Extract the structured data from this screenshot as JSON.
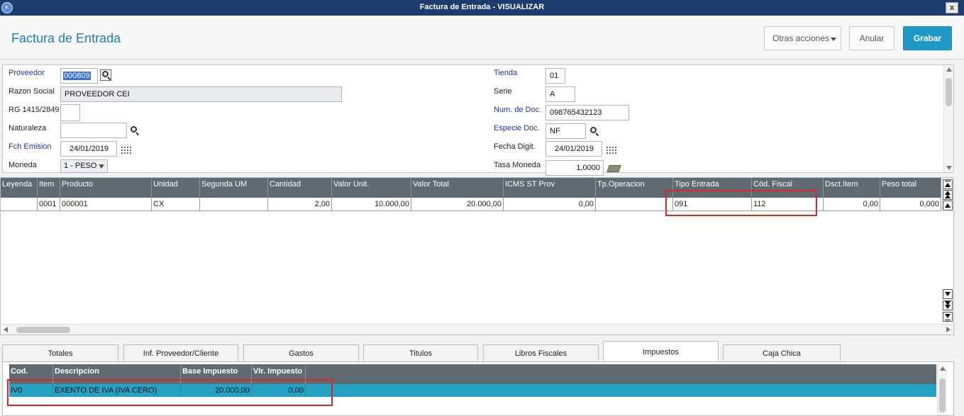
{
  "window": {
    "title": "Factura de Entrada - VISUALIZAR",
    "close_glyph": "x"
  },
  "header": {
    "page_title": "Factura de Entrada",
    "buttons": {
      "otras": "Otras acciones",
      "anular": "Anular",
      "grabar": "Grabar"
    }
  },
  "form": {
    "proveedor": {
      "label": "Proveedor",
      "value": "000809"
    },
    "razon_social": {
      "label": "Razon Social",
      "value": "PROVEEDOR CEI"
    },
    "rg": {
      "label": "RG 1415/2849",
      "value": ""
    },
    "naturaleza": {
      "label": "Naturaleza",
      "value": ""
    },
    "fch_emision": {
      "label": "Fch Emision",
      "value": "24/01/2019"
    },
    "moneda": {
      "label": "Moneda",
      "value": "1 - PESO"
    },
    "tienda": {
      "label": "Tienda",
      "value": "01"
    },
    "serie": {
      "label": "Serie",
      "value": "A"
    },
    "num_doc": {
      "label": "Num. de Doc.",
      "value": "098765432123"
    },
    "especie_doc": {
      "label": "Especie Doc.",
      "value": "NF"
    },
    "fecha_digit": {
      "label": "Fecha Digit.",
      "value": "24/01/2019"
    },
    "tasa_moneda": {
      "label": "Tasa Moneda",
      "value": "1,0000"
    }
  },
  "items_grid": {
    "columns": [
      "Leyenda",
      "Item",
      "Producto",
      "Unidad",
      "Segunda UM",
      "Cantidad",
      "Valor Unit.",
      "Valor Total",
      "ICMS ST Prov",
      "Tp.Operacion",
      "Tipo Entrada",
      "Cód. Fiscal",
      "Dsct.Item",
      "Peso total"
    ],
    "rows": [
      [
        "",
        "0001",
        "000001",
        "CX",
        "",
        "2,00",
        "10.000,00",
        "20.000,00",
        "0,00",
        "",
        "091",
        "112",
        "0,00",
        "0,000"
      ]
    ]
  },
  "tabs": [
    "Totales",
    "Inf. Proveedor/Cliente",
    "Gastos",
    "Titulos",
    "Libros Fiscales",
    "Impuestos",
    "Caja Chica"
  ],
  "active_tab": "Impuestos",
  "tax_grid": {
    "columns": [
      "Cod.",
      "Descripcion",
      "Base Impuesto",
      "Vlr. Impuesto"
    ],
    "rows": [
      [
        "IV0",
        "EXENTO DE IVA (IVA CERO)",
        "20.000,00",
        "0,00"
      ]
    ]
  },
  "colors": {
    "title_bar": "#1c3c6e",
    "accent": "#1e9ac7",
    "grid_header": "#5f6a71",
    "selected_row": "#23a2c6",
    "highlight_box": "#d8262b",
    "required_label": "#1a33a8"
  }
}
